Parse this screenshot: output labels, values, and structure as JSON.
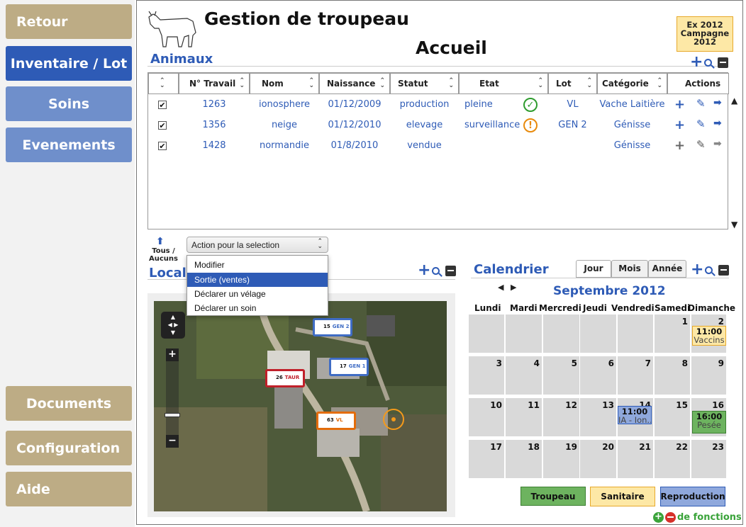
{
  "sidebar": {
    "retour": "Retour",
    "inventaire": "Inventaire / Lot",
    "soins": "Soins",
    "evenements": "Evenements",
    "documents": "Documents",
    "configuration": "Configuration",
    "aide": "Aide"
  },
  "header": {
    "app_title": "Gestion de troupeau",
    "page_title": "Accueil",
    "badge_lines": [
      "Ex 2012",
      "Campagne",
      "2012"
    ]
  },
  "animaux": {
    "title": "Animaux",
    "columns": [
      "N° Travail",
      "Nom",
      "Naissance",
      "Statut",
      "Etat",
      "Lot",
      "Catégorie",
      "Actions"
    ],
    "rows": [
      {
        "checked": true,
        "num": "1263",
        "nom": "ionosphere",
        "naissance": "01/12/2009",
        "statut": "production",
        "etat": "pleine",
        "etat_icon": "check-icon",
        "lot": "VL",
        "categorie": "Vache Laitière"
      },
      {
        "checked": true,
        "num": "1356",
        "nom": "neige",
        "naissance": "01/12/2010",
        "statut": "elevage",
        "etat": "surveillance",
        "etat_icon": "warning-icon",
        "lot": "GEN 2",
        "categorie": "Génisse"
      },
      {
        "checked": true,
        "num": "1428",
        "nom": "normandie",
        "naissance": "01/8/2010",
        "statut": "vendue",
        "etat": "",
        "etat_icon": "",
        "lot": "",
        "categorie": "Génisse"
      }
    ]
  },
  "selection": {
    "tous": "Tous /",
    "aucuns": "Aucuns",
    "dropdown_value": "Action pour la selection",
    "options": [
      "Modifier",
      "Sortie (ventes)",
      "Déclarer un vélage",
      "Déclarer un soin"
    ],
    "highlighted": "Sortie (ventes)"
  },
  "localisation": {
    "title": "Local",
    "markers": [
      {
        "count": "15",
        "label": "GEN 2",
        "color": "#3f6cc4"
      },
      {
        "count": "17",
        "label": "GEN 1",
        "color": "#3f6cc4"
      },
      {
        "count": "26",
        "label": "TAUR",
        "color": "#c0202a"
      },
      {
        "count": "63",
        "label": "VL",
        "color": "#e36c0a"
      }
    ]
  },
  "calendrier": {
    "title": "Calendrier",
    "tabs": [
      "Jour",
      "Mois",
      "Année"
    ],
    "month": "Septembre 2012",
    "days": [
      "Lundi",
      "Mardi",
      "Mercredi",
      "Jeudi",
      "Vendredi",
      "Samedi",
      "Dimanche"
    ],
    "weeks": [
      [
        "",
        "",
        "",
        "",
        "",
        "1",
        "2"
      ],
      [
        "3",
        "4",
        "5",
        "6",
        "7",
        "8",
        "9"
      ],
      [
        "10",
        "11",
        "12",
        "13",
        "14",
        "15",
        "16"
      ],
      [
        "17",
        "18",
        "19",
        "20",
        "21",
        "22",
        "23"
      ]
    ],
    "events": [
      {
        "time": "11:00",
        "label": "Vaccins"
      },
      {
        "time": "11:00",
        "label": "IA - Ion..."
      },
      {
        "time": "16:00",
        "label": "Pesée"
      }
    ],
    "legend": [
      "Troupeau",
      "Sanitaire",
      "Reproduction"
    ],
    "footer": "de fonctions"
  },
  "colors": {
    "accent": "#2e5bb6",
    "tan": "#bdac85",
    "troupeau": "#6db35f",
    "sanitaire": "#fde8a6",
    "reproduction": "#8fa8dc"
  }
}
